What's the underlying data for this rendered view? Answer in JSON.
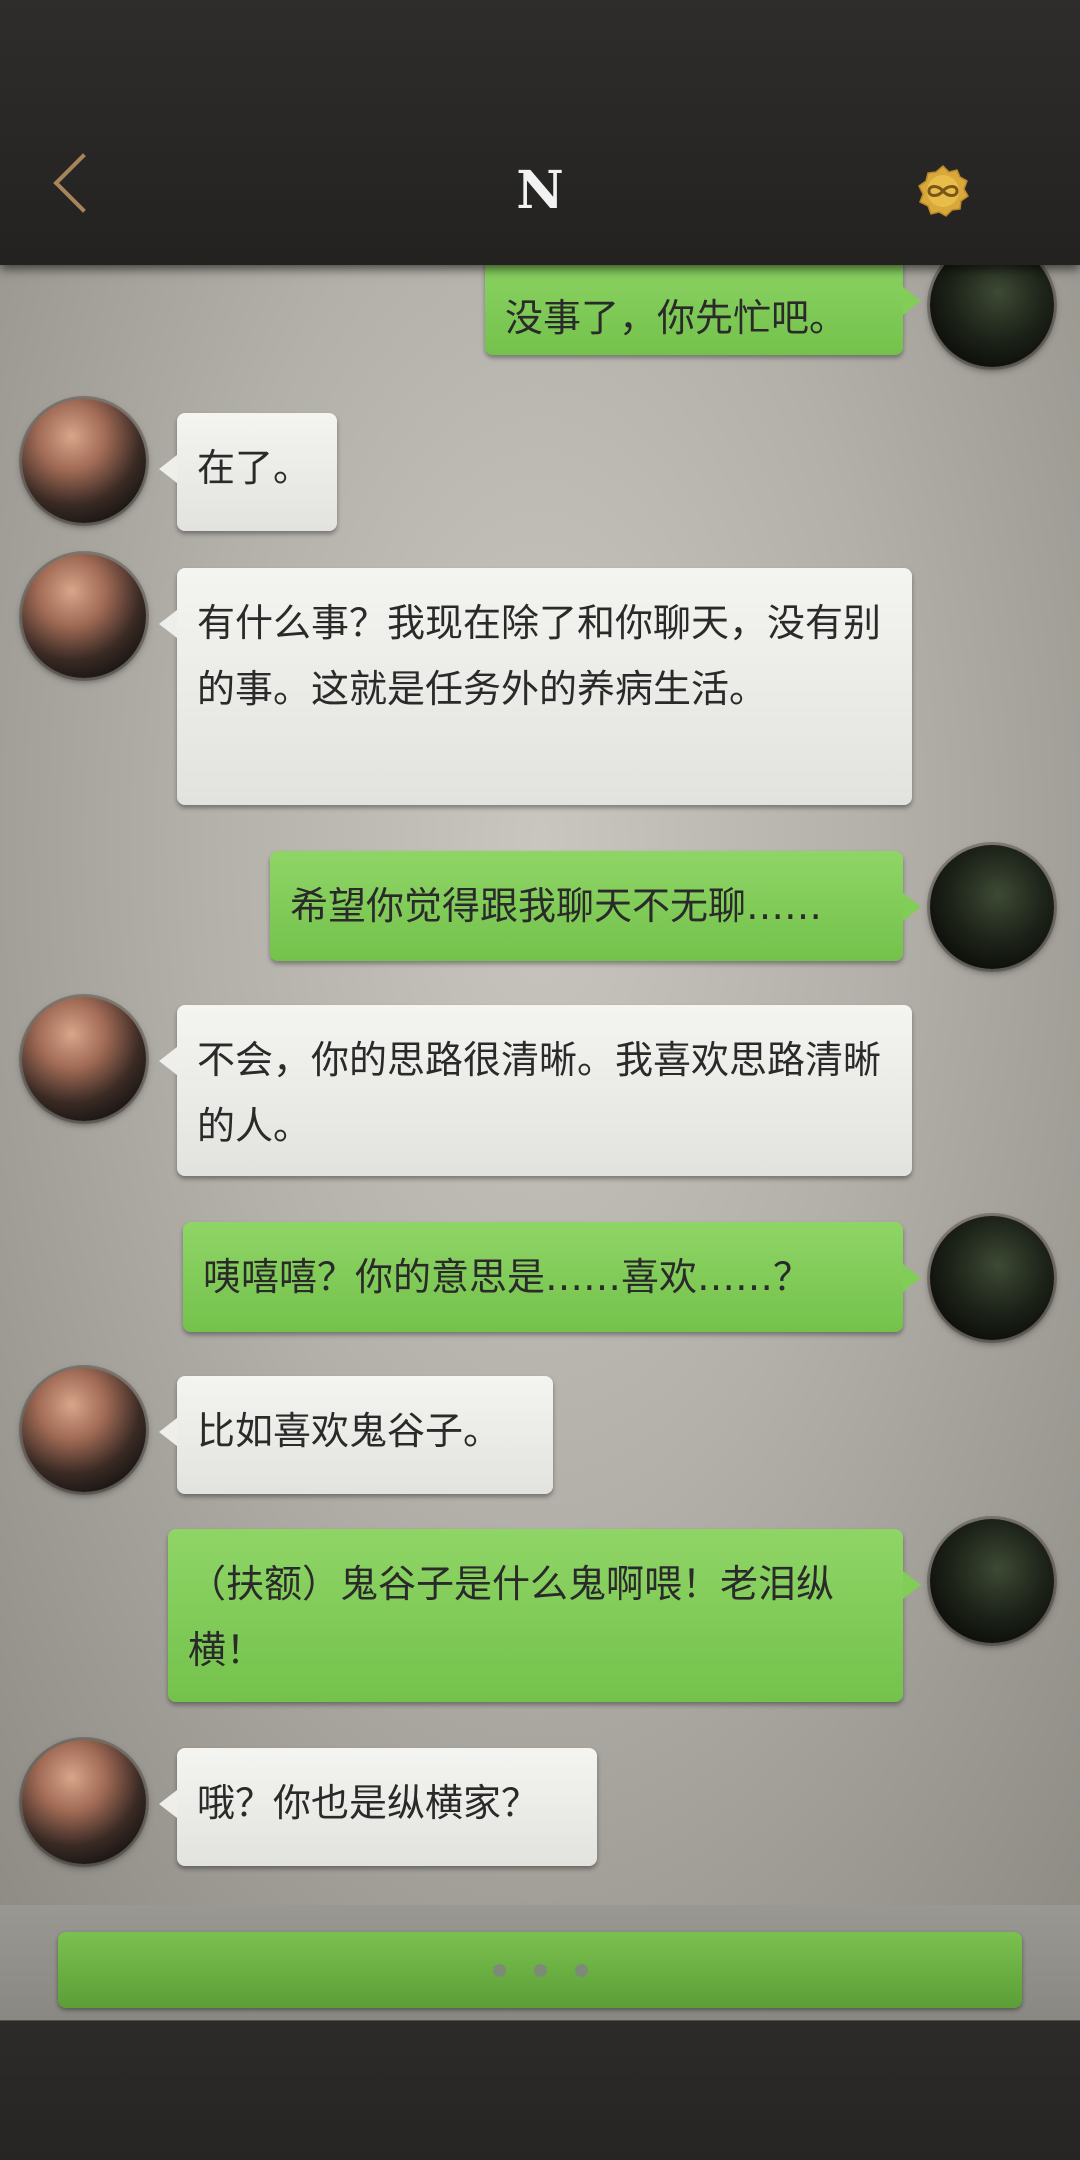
{
  "header": {
    "title": "N",
    "back_icon": "chevron-left-icon",
    "right_icon": "infinity-badge-icon"
  },
  "messages": [
    {
      "side": "right",
      "text": "没事了，你先忙吧。"
    },
    {
      "side": "left",
      "text": "在了。"
    },
    {
      "side": "left",
      "text": "有什么事？我现在除了和你聊天，没有别的事。这就是任务外的养病生活。"
    },
    {
      "side": "right",
      "text": "希望你觉得跟我聊天不无聊……"
    },
    {
      "side": "left",
      "text": "不会，你的思路很清晰。我喜欢思路清晰的人。"
    },
    {
      "side": "right",
      "text": "咦嘻嘻？你的意思是……喜欢……？"
    },
    {
      "side": "left",
      "text": "比如喜欢鬼谷子。"
    },
    {
      "side": "right",
      "text": "（扶额）鬼谷子是什么鬼啊喂！老泪纵横！"
    },
    {
      "side": "left",
      "text": "哦？你也是纵横家？"
    }
  ],
  "input_bar": {
    "icon": "typing-dots-icon"
  },
  "colors": {
    "accent_green": "#7bc14f",
    "header_bg": "#2b2a28",
    "back_arrow": "#a8845a"
  }
}
